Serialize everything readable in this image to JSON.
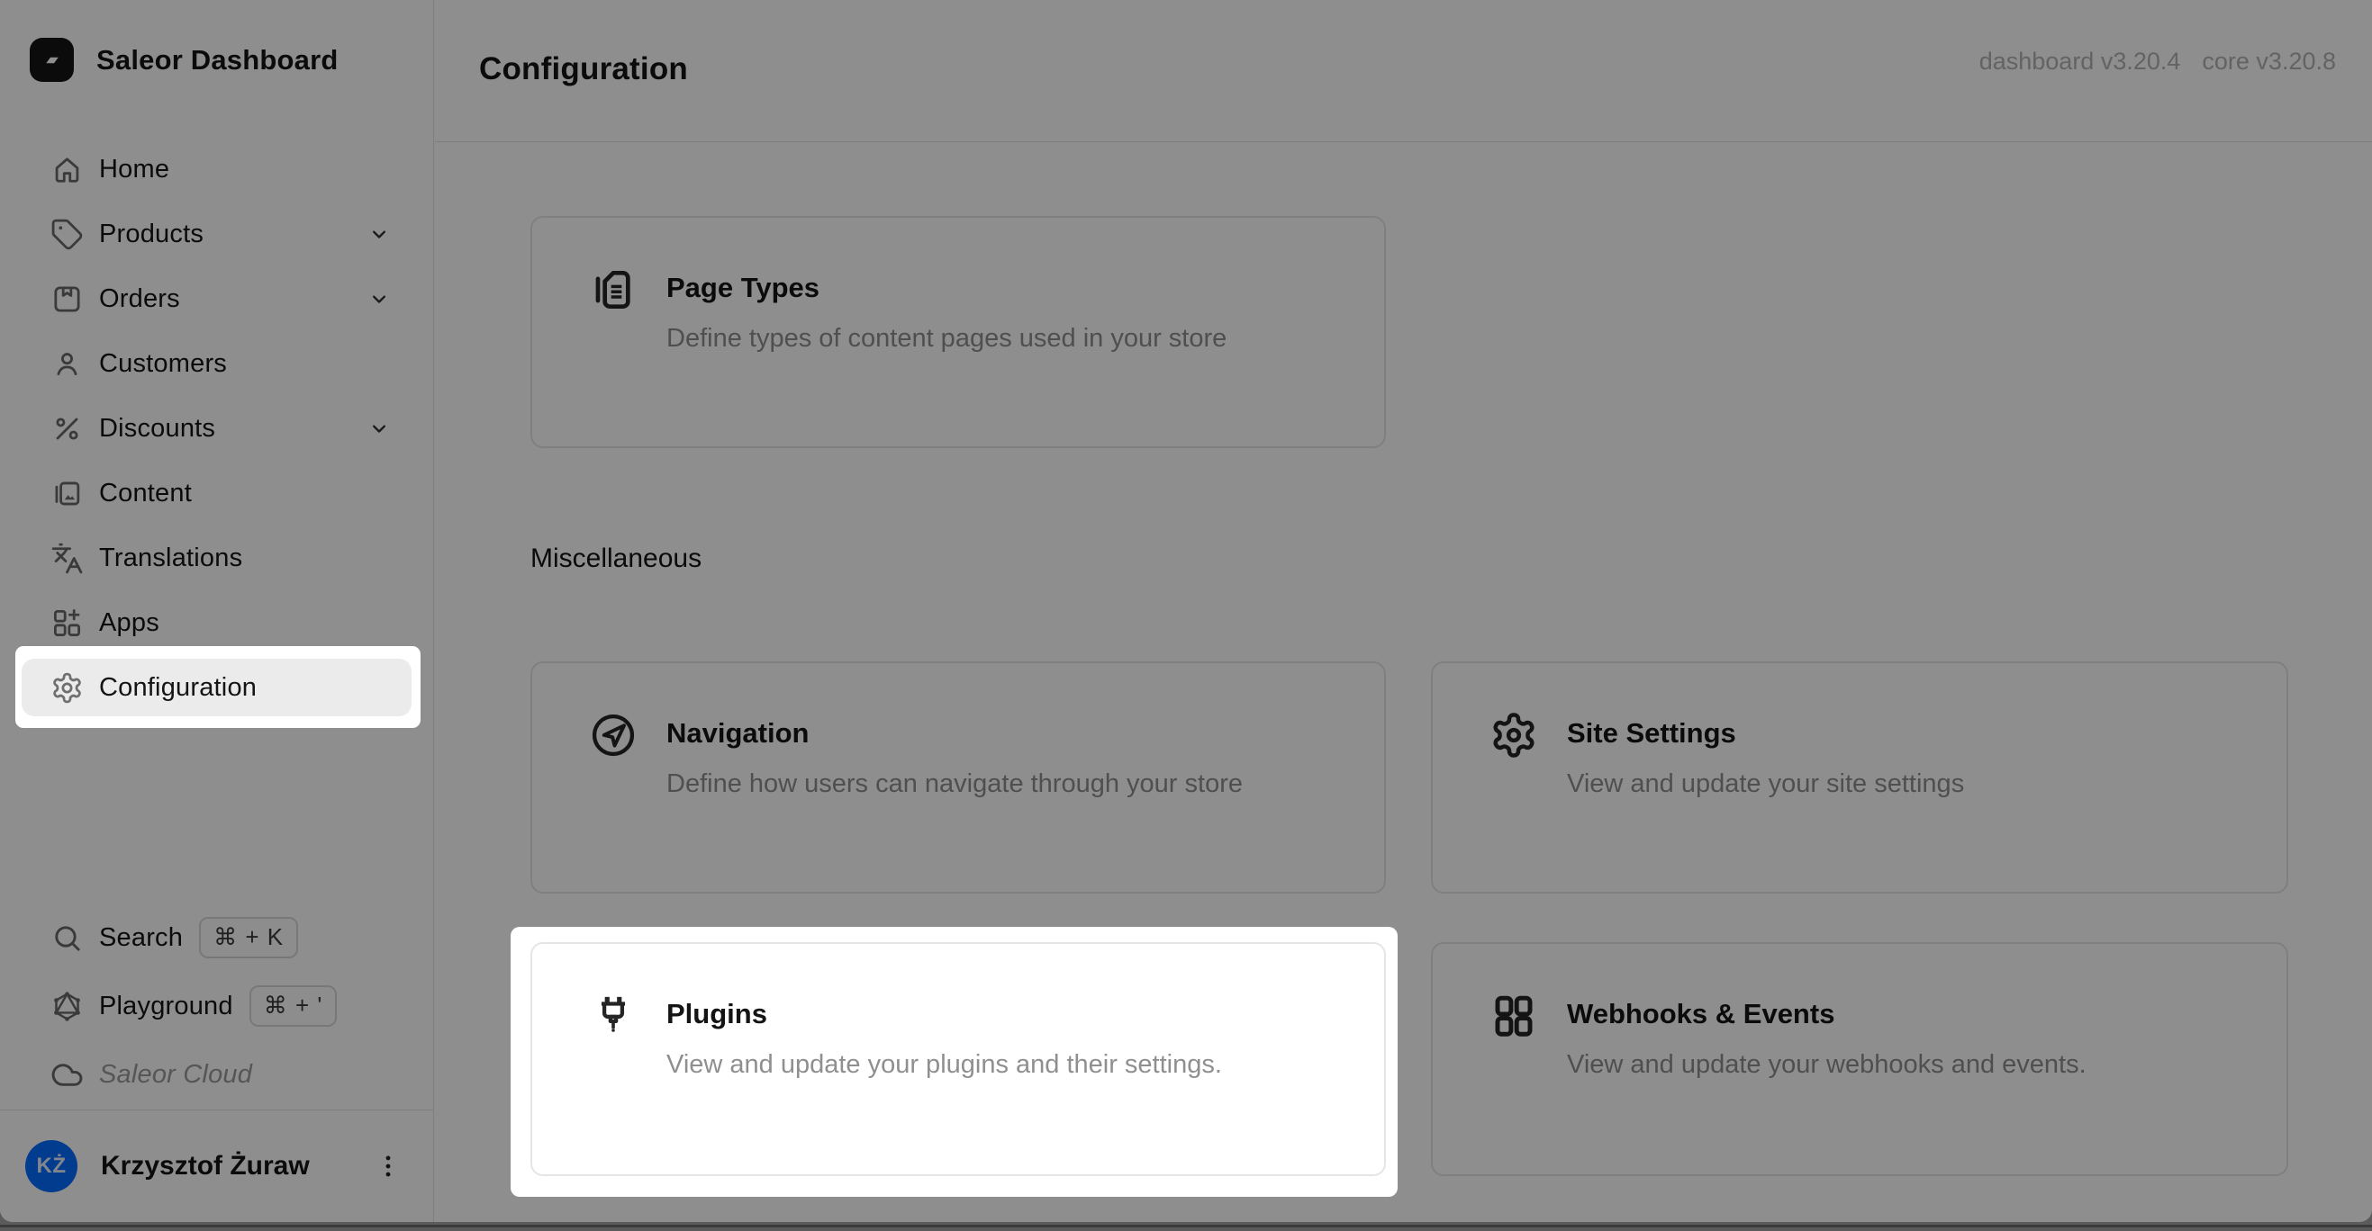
{
  "app": {
    "brand": "Saleor Dashboard"
  },
  "header": {
    "title": "Configuration",
    "versions": {
      "dashboard": "dashboard v3.20.4",
      "core": "core v3.20.8"
    }
  },
  "sidebar": {
    "items": [
      {
        "label": "Home",
        "icon": "home-icon",
        "expandable": false,
        "selected": false
      },
      {
        "label": "Products",
        "icon": "tag-icon",
        "expandable": true,
        "selected": false
      },
      {
        "label": "Orders",
        "icon": "package-icon",
        "expandable": true,
        "selected": false
      },
      {
        "label": "Customers",
        "icon": "person-icon",
        "expandable": false,
        "selected": false
      },
      {
        "label": "Discounts",
        "icon": "percent-icon",
        "expandable": true,
        "selected": false
      },
      {
        "label": "Content",
        "icon": "media-folder-icon",
        "expandable": false,
        "selected": false
      },
      {
        "label": "Translations",
        "icon": "languages-icon",
        "expandable": false,
        "selected": false
      },
      {
        "label": "Apps",
        "icon": "grid-plus-icon",
        "expandable": false,
        "selected": false
      },
      {
        "label": "Configuration",
        "icon": "gear-icon",
        "expandable": false,
        "selected": true,
        "spotlighted": true
      }
    ],
    "tools": [
      {
        "label": "Search",
        "icon": "search-icon",
        "shortcut": "⌘ + K"
      },
      {
        "label": "Playground",
        "icon": "graphql-icon",
        "shortcut": "⌘ + '"
      },
      {
        "label": "Saleor Cloud",
        "icon": "cloud-icon",
        "shortcut": ""
      }
    ],
    "user": {
      "initials": "KŻ",
      "name": "Krzysztof Żuraw",
      "menu_icon": "kebab-menu-icon"
    }
  },
  "main": {
    "section_heading": "Miscellaneous",
    "cards": {
      "page_types": {
        "title": "Page Types",
        "desc": "Define types of content pages used in your store",
        "icon": "page-types-icon"
      },
      "navigation": {
        "title": "Navigation",
        "desc": "Define how users can navigate through your store",
        "icon": "navigation-icon"
      },
      "site_settings": {
        "title": "Site Settings",
        "desc": "View and update your site settings",
        "icon": "gear-icon"
      },
      "plugins": {
        "title": "Plugins",
        "desc": "View and update your plugins and their settings.",
        "icon": "plug-icon",
        "spotlighted": true
      },
      "webhooks": {
        "title": "Webhooks & Events",
        "desc": "View and update your webhooks and events.",
        "icon": "grid-icon"
      }
    }
  },
  "colors": {
    "avatar_bg": "#056dff",
    "selected_item_bg": "#ebebeb",
    "card_border": "#e5e5e5",
    "dim_overlay": "rgba(0,0,0,0.445)",
    "muted_text": "#8f8f8f",
    "version_text": "#b3b3b3"
  }
}
